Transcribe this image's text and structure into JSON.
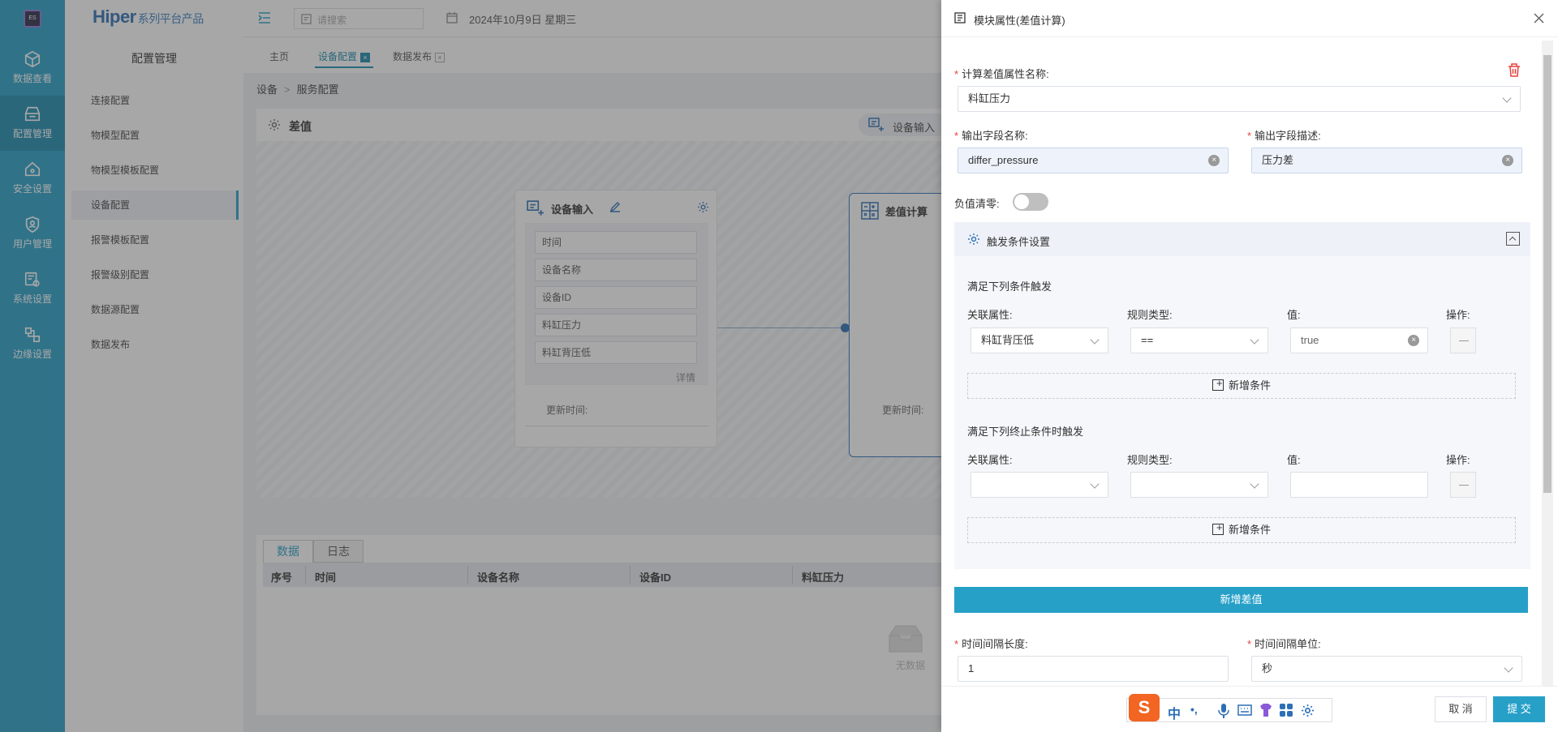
{
  "app": {
    "brand": "Hiper",
    "brand_sub": "系列平台产品",
    "logo_text": "ES"
  },
  "rail": [
    {
      "label": "数据查看",
      "icon": "cube-icon"
    },
    {
      "label": "配置管理",
      "icon": "config-icon"
    },
    {
      "label": "安全设置",
      "icon": "shield-home-icon"
    },
    {
      "label": "用户管理",
      "icon": "user-shield-icon"
    },
    {
      "label": "系统设置",
      "icon": "system-settings-icon"
    },
    {
      "label": "边缘设置",
      "icon": "edge-icon"
    }
  ],
  "side": {
    "title": "配置管理",
    "items": [
      "连接配置",
      "物模型配置",
      "物模型模板配置",
      "设备配置",
      "报警模板配置",
      "报警级别配置",
      "数据源配置",
      "数据发布"
    ]
  },
  "topbar": {
    "search_placeholder": "请搜索",
    "date": "2024年10月9日 星期三"
  },
  "tabs": [
    "主页",
    "设备配置",
    "数据发布"
  ],
  "breadcrumb": [
    "设备",
    "服务配置"
  ],
  "canvas": {
    "header": "差值",
    "header_right": "设备输入",
    "node1": {
      "title": "设备输入",
      "fields": [
        "时间",
        "设备名称",
        "设备ID",
        "料缸压力",
        "料缸背压低"
      ],
      "detail": "详情",
      "update": "更新时间:"
    },
    "node2": {
      "title": "差值计算",
      "update": "更新时间:"
    }
  },
  "bottom": {
    "tabs": [
      "数据",
      "日志"
    ],
    "columns": [
      "序号",
      "时间",
      "设备名称",
      "设备ID",
      "料缸压力"
    ],
    "empty": "无数据"
  },
  "drawer": {
    "title": "模块属性(差值计算)",
    "attr_name_label": "计算差值属性名称:",
    "attr_name_value": "料缸压力",
    "out_field_label": "输出字段名称:",
    "out_field_value": "differ_pressure",
    "out_desc_label": "输出字段描述:",
    "out_desc_value": "压力差",
    "neg_zero_label": "负值清零:",
    "trigger_section": "触发条件设置",
    "cond1": {
      "heading": "满足下列条件触发",
      "col_attr": "关联属性:",
      "col_rule": "规则类型:",
      "col_val": "值:",
      "col_op": "操作:",
      "attr": "料缸背压低",
      "rule": "==",
      "value": "true",
      "add": "新增条件"
    },
    "cond2": {
      "heading": "满足下列终止条件时触发",
      "col_attr": "关联属性:",
      "col_rule": "规则类型:",
      "col_val": "值:",
      "col_op": "操作:",
      "attr": "",
      "rule": "",
      "value": "",
      "add": "新增条件"
    },
    "add_diff": "新增差值",
    "interval_len_label": "时间间隔长度:",
    "interval_len_value": "1",
    "interval_unit_label": "时间间隔单位:",
    "interval_unit_value": "秒",
    "cancel": "取 消",
    "submit": "提 交"
  },
  "ime": {
    "chars": [
      "中",
      "•,"
    ]
  },
  "colors": {
    "primary": "#27a0c8",
    "danger": "#e8403b"
  }
}
